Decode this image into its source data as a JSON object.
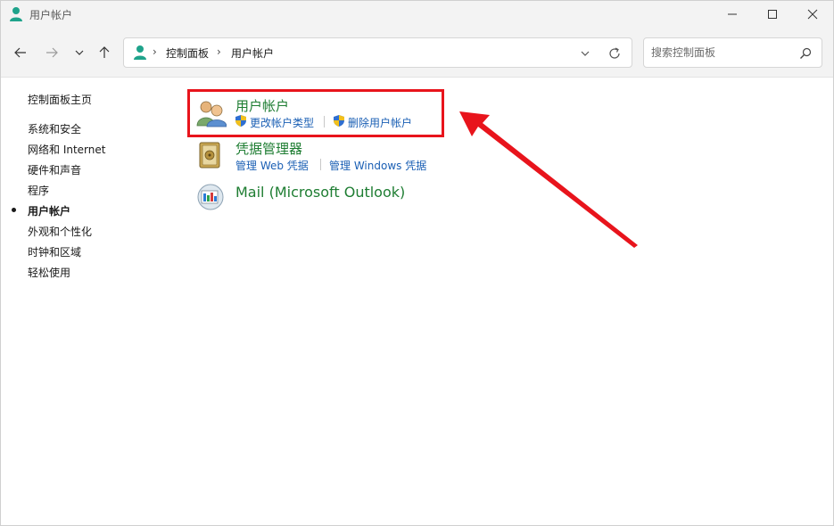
{
  "window": {
    "title": "用户帐户"
  },
  "address": {
    "crumbs": [
      "控制面板",
      "用户帐户"
    ]
  },
  "search": {
    "placeholder": "搜索控制面板"
  },
  "leftnav": {
    "home": "控制面板主页",
    "items": [
      {
        "label": "系统和安全",
        "active": false
      },
      {
        "label": "网络和 Internet",
        "active": false
      },
      {
        "label": "硬件和声音",
        "active": false
      },
      {
        "label": "程序",
        "active": false
      },
      {
        "label": "用户帐户",
        "active": true
      },
      {
        "label": "外观和个性化",
        "active": false
      },
      {
        "label": "时钟和区域",
        "active": false
      },
      {
        "label": "轻松使用",
        "active": false
      }
    ]
  },
  "categories": [
    {
      "title": "用户帐户",
      "icon": "user-accounts-icon",
      "links": [
        "更改帐户类型",
        "删除用户帐户"
      ]
    },
    {
      "title": "凭据管理器",
      "icon": "credential-manager-icon",
      "links": [
        "管理 Web 凭据",
        "管理 Windows 凭据"
      ]
    },
    {
      "title": "Mail (Microsoft Outlook)",
      "icon": "mail-icon",
      "links": []
    }
  ],
  "colors": {
    "category_title": "#1e7d32",
    "link": "#1a5fb4",
    "highlight": "#e8141c"
  }
}
